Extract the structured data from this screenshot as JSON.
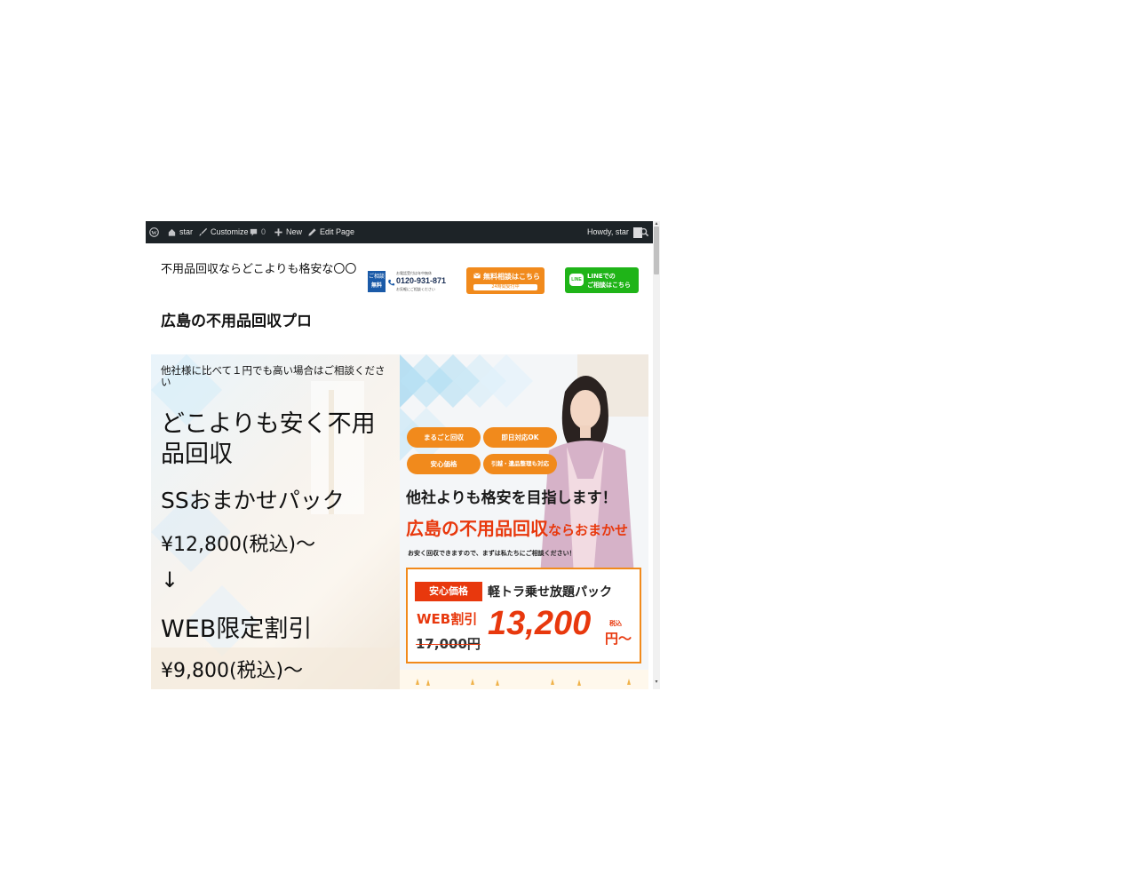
{
  "admin_bar": {
    "site": "star",
    "customize": "Customize",
    "comments": "0",
    "new": "New",
    "edit_page": "Edit Page",
    "howdy": "Howdy, star"
  },
  "header": {
    "tagline": "不用品回収ならどこよりも格安な〇〇",
    "site_title": "広島の不用品回収プロ",
    "phone": {
      "badge_line1": "ご相談",
      "badge_line2": "無料",
      "top_note": "お電話受付は年中無休",
      "number": "0120-931-871",
      "bottom_note": "お気軽にご相談ください"
    },
    "contact_button": {
      "label": "無料相談はこちら",
      "sub": "24時間受付中"
    },
    "line_button": {
      "badge": "LINE",
      "line1": "LINEでの",
      "line2": "ご相談はこちら"
    }
  },
  "hero": {
    "note": "他社様に比べて１円でも高い場合はご相談ください",
    "headline": "どこよりも安く不用品回収",
    "plan": "SSおまかせパック",
    "price_regular": "¥12,800(税込)～",
    "arrow": "↓",
    "web_label": "WEB限定割引",
    "price_web": "¥9,800(税込)～"
  },
  "banner": {
    "pills": [
      "まるごと回収",
      "即日対応OK",
      "安心価格",
      "引越・遺品整理も対応"
    ],
    "heading1": "他社よりも格安を目指します！",
    "heading2_main": "広島の不用品回収",
    "heading2_suffix": "ならおまかせ",
    "sub": "お安く回収できますので、まずは私たちにご相談ください！",
    "tag": "安心価格",
    "pack": "軽トラ乗せ放題パック",
    "web_discount": "WEB割引",
    "old_price": "17,000円",
    "new_price": "13,200",
    "yen": "円～",
    "tax": "税込"
  },
  "colors": {
    "admin_bar": "#1d2327",
    "orange": "#f18a1c",
    "accent_red": "#e8380d",
    "line_green": "#1fb418"
  }
}
